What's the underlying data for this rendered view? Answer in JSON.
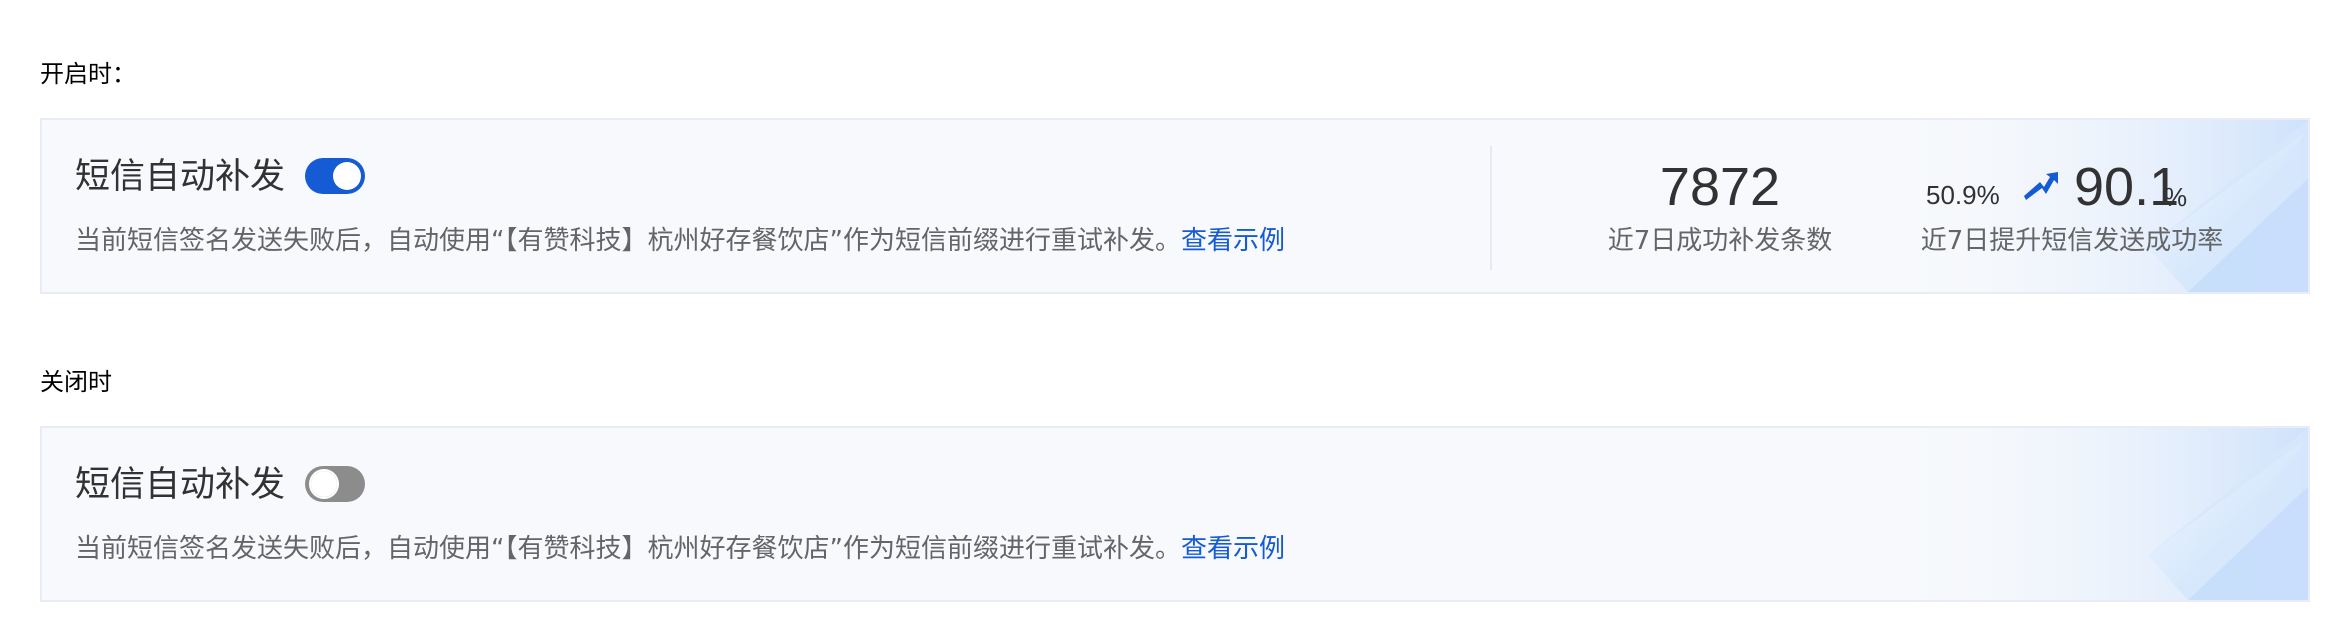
{
  "sections": {
    "on_label": "开启时：",
    "off_label": "关闭时"
  },
  "card_on": {
    "title": "短信自动补发",
    "toggle_state": "on",
    "description": "当前短信签名发送失败后，自动使用“【有赞科技】杭州好存餐饮店”作为短信前缀进行重试补发。",
    "link": "查看示例",
    "stats": {
      "resend_count": "7872",
      "resend_count_label": "近7日成功补发条数",
      "rate_before": "50.9%",
      "rate_after": "90.1",
      "rate_after_unit": "%",
      "rate_label": "近7日提升短信发送成功率"
    }
  },
  "card_off": {
    "title": "短信自动补发",
    "toggle_state": "off",
    "description": "当前短信签名发送失败后，自动使用“【有赞科技】杭州好存餐饮店”作为短信前缀进行重试补发。",
    "link": "查看示例"
  },
  "colors": {
    "accent": "#155bd4",
    "toggle_off": "#8c8c8c",
    "card_bg": "#f7f9fc",
    "card_border": "#e8edf5"
  },
  "icons": {
    "trend": "trend-up-arrow-icon"
  }
}
